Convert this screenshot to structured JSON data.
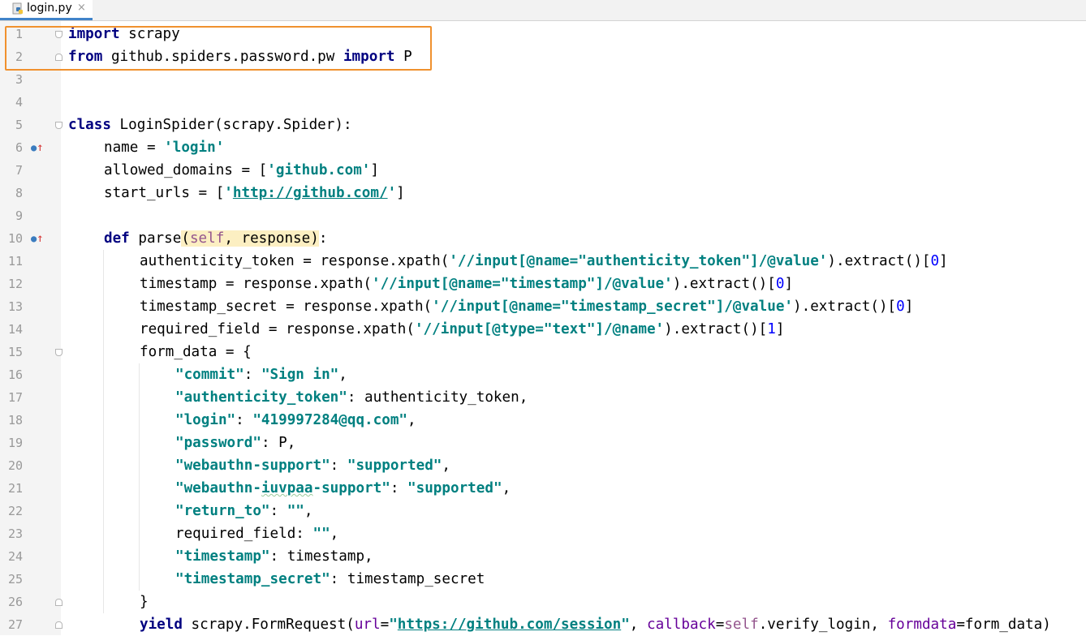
{
  "tab": {
    "filename": "login.py",
    "close_glyph": "×",
    "icon": "python-file-icon"
  },
  "colors": {
    "keyword": "#000080",
    "string": "#008080",
    "self": "#94558d",
    "param": "#660099",
    "number": "#0000ff",
    "highlight_box": "#f0912e",
    "active_tab_underline": "#4083c9"
  },
  "editor": {
    "lines": [
      {
        "n": "1",
        "indent": 0,
        "tokens": [
          {
            "t": "import",
            "c": "kw"
          },
          {
            "t": " scrapy"
          }
        ]
      },
      {
        "n": "2",
        "indent": 0,
        "tokens": [
          {
            "t": "from",
            "c": "kw"
          },
          {
            "t": " github.spiders.password.pw "
          },
          {
            "t": "import",
            "c": "kw"
          },
          {
            "t": " P"
          }
        ]
      },
      {
        "n": "3",
        "indent": 0,
        "tokens": []
      },
      {
        "n": "4",
        "indent": 0,
        "tokens": []
      },
      {
        "n": "5",
        "indent": 0,
        "tokens": [
          {
            "t": "class",
            "c": "kw"
          },
          {
            "t": " LoginSpider(scrapy.Spider):"
          }
        ]
      },
      {
        "n": "6",
        "indent": 1,
        "tokens": [
          {
            "t": "name = "
          },
          {
            "t": "'login'",
            "c": "str"
          }
        ]
      },
      {
        "n": "7",
        "indent": 1,
        "tokens": [
          {
            "t": "allowed_domains = ["
          },
          {
            "t": "'github.com'",
            "c": "str"
          },
          {
            "t": "]"
          }
        ]
      },
      {
        "n": "8",
        "indent": 1,
        "tokens": [
          {
            "t": "start_urls = ["
          },
          {
            "t": "'",
            "c": "str"
          },
          {
            "t": "http://github.com/",
            "c": "link"
          },
          {
            "t": "'",
            "c": "str"
          },
          {
            "t": "]"
          }
        ]
      },
      {
        "n": "9",
        "indent": 0,
        "tokens": []
      },
      {
        "n": "10",
        "indent": 1,
        "tokens": [
          {
            "t": "def",
            "c": "kw"
          },
          {
            "t": " parse"
          },
          {
            "t": "(",
            "c": "hl"
          },
          {
            "t": "self",
            "c": "slf hl"
          },
          {
            "t": ", response)",
            "c": "hl"
          },
          {
            "t": ":"
          }
        ]
      },
      {
        "n": "11",
        "indent": 2,
        "tokens": [
          {
            "t": "authenticity_token = response.xpath("
          },
          {
            "t": "'//input[@name=\"authenticity_token\"]/@value'",
            "c": "str"
          },
          {
            "t": ").extract()["
          },
          {
            "t": "0",
            "c": "num"
          },
          {
            "t": "]"
          }
        ]
      },
      {
        "n": "12",
        "indent": 2,
        "tokens": [
          {
            "t": "timestamp = response.xpath("
          },
          {
            "t": "'//input[@name=\"timestamp\"]/@value'",
            "c": "str"
          },
          {
            "t": ").extract()["
          },
          {
            "t": "0",
            "c": "num"
          },
          {
            "t": "]"
          }
        ]
      },
      {
        "n": "13",
        "indent": 2,
        "tokens": [
          {
            "t": "timestamp_secret = response.xpath("
          },
          {
            "t": "'//input[@name=\"timestamp_secret\"]/@value'",
            "c": "str"
          },
          {
            "t": ").extract()["
          },
          {
            "t": "0",
            "c": "num"
          },
          {
            "t": "]"
          }
        ]
      },
      {
        "n": "14",
        "indent": 2,
        "tokens": [
          {
            "t": "required_field = response.xpath("
          },
          {
            "t": "'//input[@type=\"text\"]/@name'",
            "c": "str"
          },
          {
            "t": ").extract()["
          },
          {
            "t": "1",
            "c": "num"
          },
          {
            "t": "]"
          }
        ]
      },
      {
        "n": "15",
        "indent": 2,
        "tokens": [
          {
            "t": "form_data = {"
          }
        ]
      },
      {
        "n": "16",
        "indent": 3,
        "tokens": [
          {
            "t": "\"commit\"",
            "c": "str"
          },
          {
            "t": ": "
          },
          {
            "t": "\"Sign in\"",
            "c": "str"
          },
          {
            "t": ","
          }
        ]
      },
      {
        "n": "17",
        "indent": 3,
        "tokens": [
          {
            "t": "\"authenticity_token\"",
            "c": "str"
          },
          {
            "t": ": authenticity_token,"
          }
        ]
      },
      {
        "n": "18",
        "indent": 3,
        "tokens": [
          {
            "t": "\"login\"",
            "c": "str"
          },
          {
            "t": ": "
          },
          {
            "t": "\"419997284@qq.com\"",
            "c": "str"
          },
          {
            "t": ","
          }
        ]
      },
      {
        "n": "19",
        "indent": 3,
        "tokens": [
          {
            "t": "\"password\"",
            "c": "str"
          },
          {
            "t": ": P,"
          }
        ]
      },
      {
        "n": "20",
        "indent": 3,
        "tokens": [
          {
            "t": "\"webauthn-support\"",
            "c": "str"
          },
          {
            "t": ": "
          },
          {
            "t": "\"supported\"",
            "c": "str"
          },
          {
            "t": ","
          }
        ]
      },
      {
        "n": "21",
        "indent": 3,
        "tokens": [
          {
            "t": "\"webauthn-",
            "c": "str"
          },
          {
            "t": "iuvpaa",
            "c": "str squig"
          },
          {
            "t": "-support\"",
            "c": "str"
          },
          {
            "t": ": "
          },
          {
            "t": "\"supported\"",
            "c": "str"
          },
          {
            "t": ","
          }
        ]
      },
      {
        "n": "22",
        "indent": 3,
        "tokens": [
          {
            "t": "\"return_to\"",
            "c": "str"
          },
          {
            "t": ": "
          },
          {
            "t": "\"\"",
            "c": "str"
          },
          {
            "t": ","
          }
        ]
      },
      {
        "n": "23",
        "indent": 3,
        "tokens": [
          {
            "t": "required_field: "
          },
          {
            "t": "\"\"",
            "c": "str"
          },
          {
            "t": ","
          }
        ]
      },
      {
        "n": "24",
        "indent": 3,
        "tokens": [
          {
            "t": "\"timestamp\"",
            "c": "str"
          },
          {
            "t": ": timestamp,"
          }
        ]
      },
      {
        "n": "25",
        "indent": 3,
        "tokens": [
          {
            "t": "\"timestamp_secret\"",
            "c": "str"
          },
          {
            "t": ": timestamp_secret"
          }
        ]
      },
      {
        "n": "26",
        "indent": 2,
        "tokens": [
          {
            "t": "}"
          }
        ]
      },
      {
        "n": "27",
        "indent": 2,
        "tokens": [
          {
            "t": "yield",
            "c": "kw"
          },
          {
            "t": " scrapy.FormRequest("
          },
          {
            "t": "url",
            "c": "prm"
          },
          {
            "t": "="
          },
          {
            "t": "\"",
            "c": "str"
          },
          {
            "t": "https://github.com/session",
            "c": "link"
          },
          {
            "t": "\"",
            "c": "str"
          },
          {
            "t": ", "
          },
          {
            "t": "callback",
            "c": "prm"
          },
          {
            "t": "="
          },
          {
            "t": "self",
            "c": "slf"
          },
          {
            "t": ".verify_login, "
          },
          {
            "t": "formdata",
            "c": "prm"
          },
          {
            "t": "=form_data)"
          }
        ]
      }
    ],
    "fold_markers": [
      {
        "line": "1",
        "kind": "open"
      },
      {
        "line": "2",
        "kind": "close"
      },
      {
        "line": "5",
        "kind": "open"
      },
      {
        "line": "15",
        "kind": "open"
      },
      {
        "line": "26",
        "kind": "close"
      },
      {
        "line": "27",
        "kind": "close"
      }
    ],
    "override_markers": [
      {
        "line": "6",
        "icon": "override-method-icon",
        "dot": "●",
        "arrow": "↑"
      },
      {
        "line": "10",
        "icon": "override-method-icon",
        "dot": "●",
        "arrow": "↑"
      }
    ],
    "highlighted_lines": [
      "1",
      "2"
    ]
  }
}
